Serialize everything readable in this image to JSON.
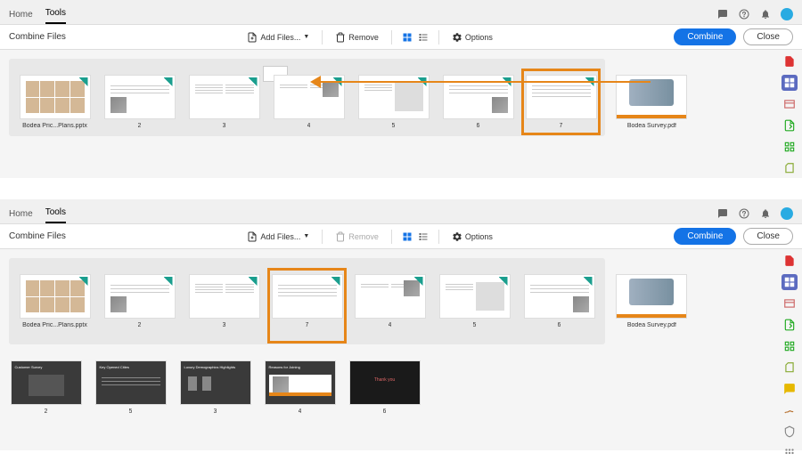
{
  "nav": {
    "home": "Home",
    "tools": "Tools"
  },
  "toolbar": {
    "title": "Combine Files",
    "add_files": "Add Files...",
    "remove": "Remove",
    "options": "Options",
    "combine": "Combine",
    "close": "Close"
  },
  "upper": {
    "group_label": "Bodea Pric...Plans.pptx",
    "pages": [
      "2",
      "3",
      "4",
      "5",
      "6",
      "7"
    ],
    "right_file": "Bodea Survey.pdf"
  },
  "lower": {
    "group_label": "Bodea Pric...Plans.pptx",
    "pages1": [
      "2",
      "3",
      "7",
      "4",
      "5",
      "6"
    ],
    "right_file": "Bodea Survey.pdf",
    "pages2": [
      "2",
      "5",
      "3",
      "4",
      "6"
    ]
  },
  "colors": {
    "accent_orange": "#e68619",
    "primary_blue": "#1473e6",
    "rail_active": "#5c6bc0"
  }
}
